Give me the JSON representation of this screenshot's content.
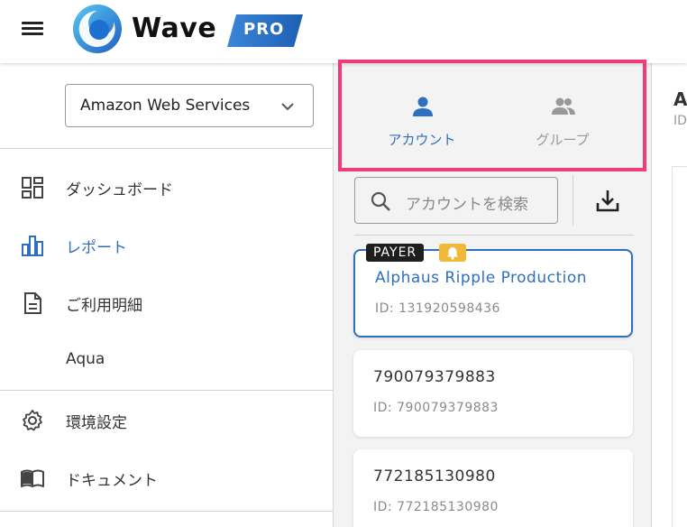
{
  "header": {
    "logo_text": "Wave",
    "logo_badge": "PRO"
  },
  "sidebar": {
    "account_select": "Amazon Web Services",
    "items": [
      {
        "label": "ダッシュボード",
        "icon": "dashboard-icon"
      },
      {
        "label": "レポート",
        "icon": "bar-chart-icon",
        "active": true
      },
      {
        "label": "ご利用明細",
        "icon": "document-icon"
      },
      {
        "label": "Aqua",
        "icon": ""
      },
      {
        "label": "環境設定",
        "icon": "gear-icon"
      },
      {
        "label": "ドキュメント",
        "icon": "book-icon"
      }
    ]
  },
  "tabs": [
    {
      "label": "アカウント",
      "icon": "person-icon",
      "active": true
    },
    {
      "label": "グループ",
      "icon": "group-icon",
      "active": false
    }
  ],
  "search": {
    "placeholder": "アカウントを検索"
  },
  "accounts": [
    {
      "name": "Alphaus Ripple Production",
      "id": "ID: 131920598436",
      "badge": "PAYER",
      "selected": true
    },
    {
      "name": "790079379883",
      "id": "ID: 790079379883"
    },
    {
      "name": "772185130980",
      "id": "ID: 772185130980"
    }
  ],
  "right_panel": {
    "title": "A",
    "subtitle": "ID"
  },
  "colors": {
    "accent": "#2f6fbf",
    "highlight": "#f23a74",
    "payer_badge": "#1e1e1e",
    "bell_badge": "#f0b93a"
  }
}
